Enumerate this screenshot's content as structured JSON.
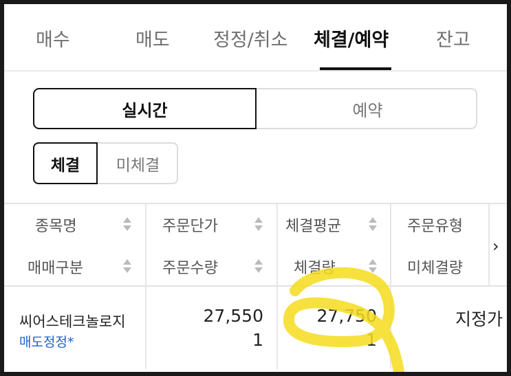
{
  "tabs": [
    "매수",
    "매도",
    "정정/취소",
    "체결/예약",
    "잔고"
  ],
  "mode_toggle": {
    "realtime": "실시간",
    "reserve": "예약"
  },
  "fill_toggle": {
    "filled": "체결",
    "unfilled": "미체결"
  },
  "columns": {
    "row1": [
      "종목명",
      "주문단가",
      "체결평균",
      "주문유형"
    ],
    "row2": [
      "매매구분",
      "주문수량",
      "체결량",
      "미체결량"
    ]
  },
  "order": {
    "stock_name": "씨어스테크놀로지",
    "trade_type": "매도정정*",
    "order_price": "27,550",
    "order_qty": "1",
    "avg_fill_price": "27,750",
    "fill_qty": "1",
    "order_type": "지정가"
  },
  "colors": {
    "highlight": "#f5dc1c",
    "link": "#1e5fcf"
  }
}
